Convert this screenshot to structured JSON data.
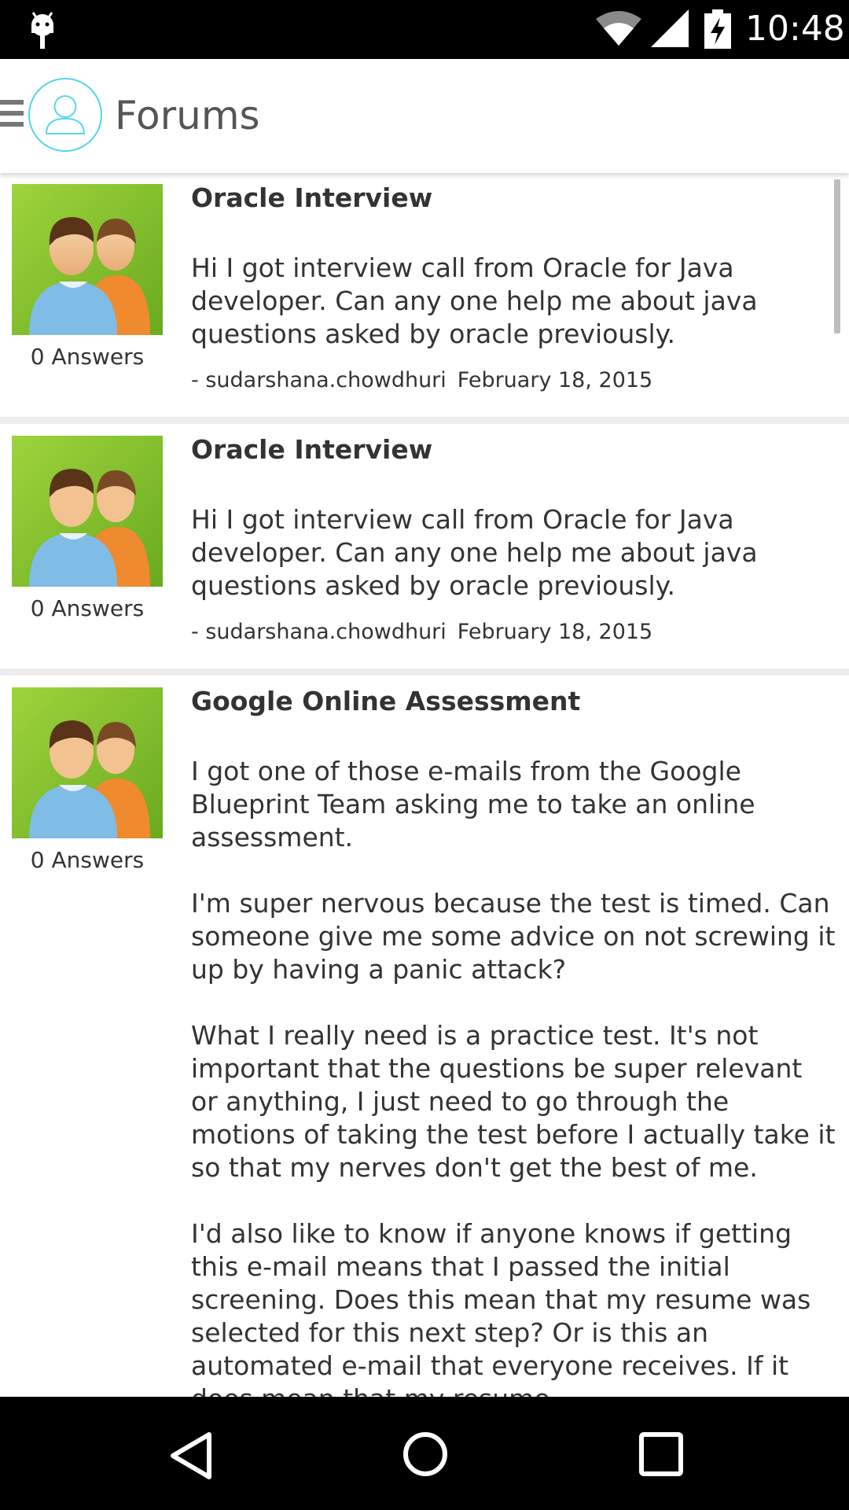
{
  "status_bar": {
    "time": "10:48",
    "icons": [
      "android-icon",
      "wifi-icon",
      "signal-icon",
      "battery-charging-icon"
    ]
  },
  "app_bar": {
    "title": "Forums",
    "icons": [
      "menu-icon",
      "avatar-icon"
    ],
    "accent_color": "#4fd6e6"
  },
  "posts": [
    {
      "title": "Oracle Interview",
      "body": "Hi I got interview call from Oracle for Java developer. Can any one help me about java questions asked by oracle previously.",
      "author": "- sudarshana.chowdhuri",
      "date": "February 18, 2015",
      "answers": "0 Answers"
    },
    {
      "title": "Oracle Interview",
      "body": "Hi I got interview call from Oracle for Java developer. Can any one help me about java questions asked by oracle previously.",
      "author": "- sudarshana.chowdhuri",
      "date": "February 18, 2015",
      "answers": "0 Answers"
    },
    {
      "title": "Google Online Assessment",
      "body": "I got one of those e-mails from the Google Blueprint Team asking me to take an online assessment.\n\nI'm super nervous because the test is timed. Can someone give me some advice on not screwing it up by having a panic attack?\n\nWhat I really need is a practice test. It's not important that the questions be super relevant or anything, I just need to go through the motions of taking the test before I actually take it so that my nerves don't get the best of me.\n\nI'd also like to know if anyone knows if getting this e-mail means that I passed the initial screening. Does this mean that my resume was selected for this next step? Or is this an automated e-mail that everyone receives. If it does mean that my resume",
      "answers": "0 Answers"
    }
  ],
  "nav_bar": {
    "icons": [
      "back-icon",
      "home-icon",
      "recents-icon"
    ]
  }
}
